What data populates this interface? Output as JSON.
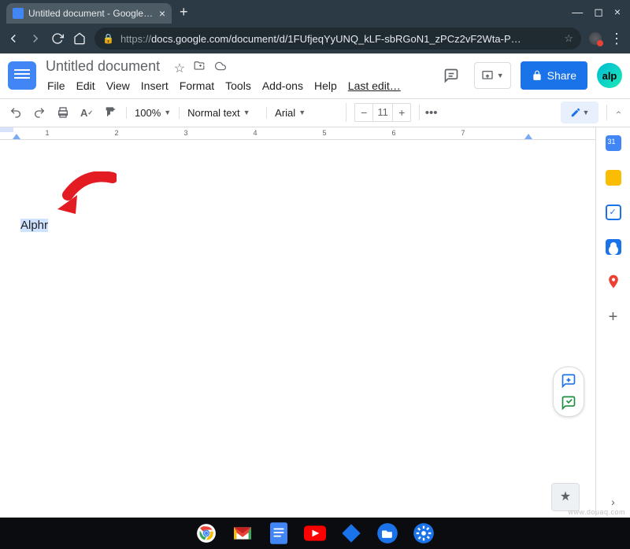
{
  "browser": {
    "tab_title": "Untitled document - Google Docs",
    "url_protocol": "https://",
    "url_rest": "docs.google.com/document/d/1FUfjeqYyUNQ_kLF-sbRGoN1_zPCz2vF2Wta-P…"
  },
  "header": {
    "doc_title": "Untitled document",
    "share_label": "Share",
    "avatar_initials": "alp",
    "last_edit": "Last edit…"
  },
  "menubar": {
    "file": "File",
    "edit": "Edit",
    "view": "View",
    "insert": "Insert",
    "format": "Format",
    "tools": "Tools",
    "addons": "Add-ons",
    "help": "Help"
  },
  "toolbar": {
    "zoom": "100%",
    "style": "Normal text",
    "font": "Arial",
    "font_size": "11"
  },
  "document": {
    "selected_text": "Alphr"
  },
  "ruler_numbers": [
    "1",
    "2",
    "3",
    "4",
    "5",
    "6",
    "7"
  ],
  "watermark": "www.douaq.com"
}
